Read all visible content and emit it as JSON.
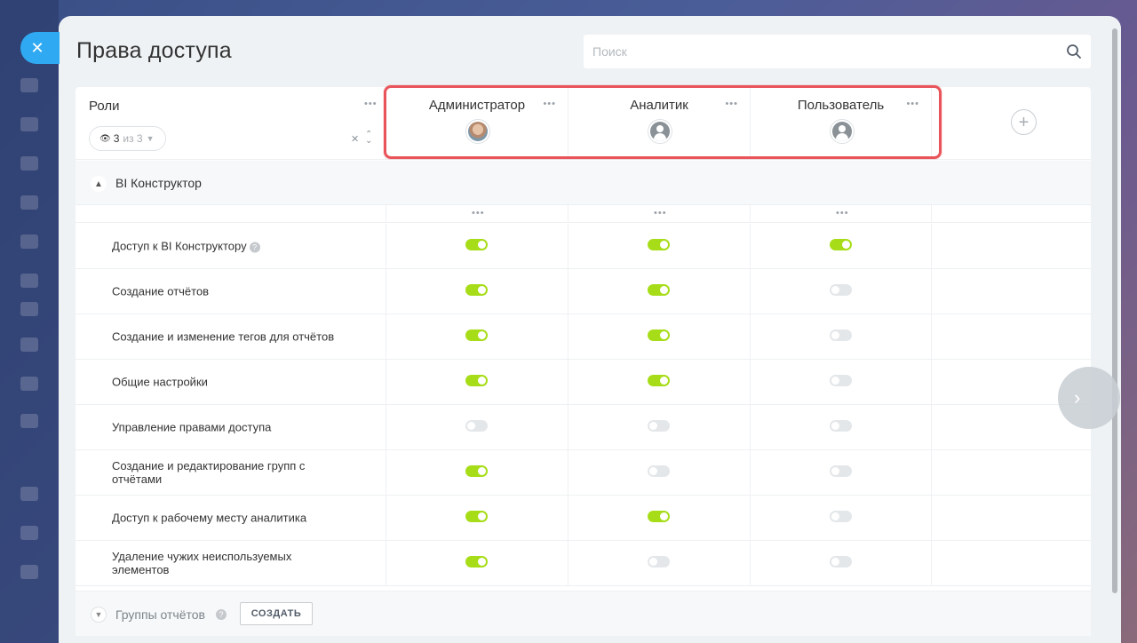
{
  "close_icon": "close-icon",
  "title": "Права доступа",
  "search": {
    "placeholder": "Поиск"
  },
  "roles_header": {
    "label": "Роли",
    "filter_count": "3",
    "filter_total": "из 3"
  },
  "roles": [
    {
      "name": "Администратор",
      "avatar": "photo"
    },
    {
      "name": "Аналитик",
      "avatar": "placeholder"
    },
    {
      "name": "Пользователь",
      "avatar": "placeholder"
    }
  ],
  "section": {
    "title": "BI Конструктор"
  },
  "permissions": [
    {
      "label": "Доступ к BI Конструктору",
      "help": true,
      "values": [
        true,
        true,
        true
      ]
    },
    {
      "label": "Создание отчётов",
      "values": [
        true,
        true,
        false
      ]
    },
    {
      "label": "Создание и изменение тегов для отчётов",
      "values": [
        true,
        true,
        false
      ]
    },
    {
      "label": "Общие настройки",
      "values": [
        true,
        true,
        false
      ]
    },
    {
      "label": "Управление правами доступа",
      "values": [
        false,
        false,
        false
      ]
    },
    {
      "label": "Создание и редактирование групп с отчётами",
      "values": [
        true,
        false,
        false
      ]
    },
    {
      "label": "Доступ к рабочему месту аналитика",
      "values": [
        true,
        true,
        false
      ]
    },
    {
      "label": "Удаление чужих неиспользуемых элементов",
      "values": [
        true,
        false,
        false
      ]
    }
  ],
  "footer": {
    "title": "Группы отчётов",
    "create_label": "СОЗДАТЬ"
  },
  "colors": {
    "toggle_on": "#a7dd18",
    "toggle_off": "#e4e7e9",
    "highlight": "#e8545a",
    "accent": "#2fa9f2"
  }
}
